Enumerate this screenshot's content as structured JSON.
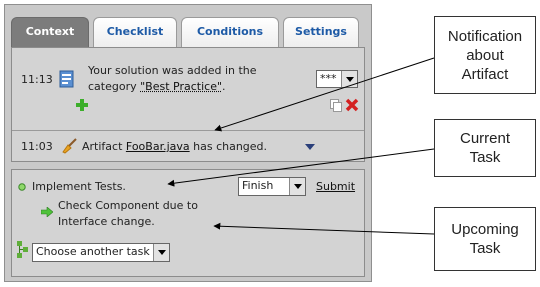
{
  "tabs": [
    {
      "label": "Context",
      "active": true
    },
    {
      "label": "Checklist",
      "active": false
    },
    {
      "label": "Conditions",
      "active": false
    },
    {
      "label": "Settings",
      "active": false
    }
  ],
  "notification1": {
    "time": "11:13",
    "text_line1": "Your solution was added in the",
    "text_line2_prefix": "category ",
    "category_link": "\"Best Practice\"",
    "text_line2_suffix": ".",
    "rating_value": "***"
  },
  "notification2": {
    "time": "11:03",
    "prefix": "Artifact ",
    "artifact_link": "FooBar.java",
    "suffix": " has changed."
  },
  "current_task": {
    "label": "Implement Tests.",
    "action_value": "Finish",
    "submit_label": "Submit"
  },
  "upcoming_task": {
    "line1": "Check Component due to",
    "line2": "Interface change."
  },
  "task_chooser": {
    "value": "Choose another task"
  },
  "callouts": {
    "notification": [
      "Notification",
      "about",
      "Artifact"
    ],
    "current": [
      "Current",
      "Task"
    ],
    "upcoming": [
      "Upcoming",
      "Task"
    ]
  },
  "colors": {
    "active_tab": "#7c7c7c",
    "tab_text": "#1d5aa6",
    "panel_bg": "#c9c9c9",
    "content_bg": "#d3d3d3",
    "delete_red": "#d42020",
    "add_green": "#3cae2a"
  }
}
